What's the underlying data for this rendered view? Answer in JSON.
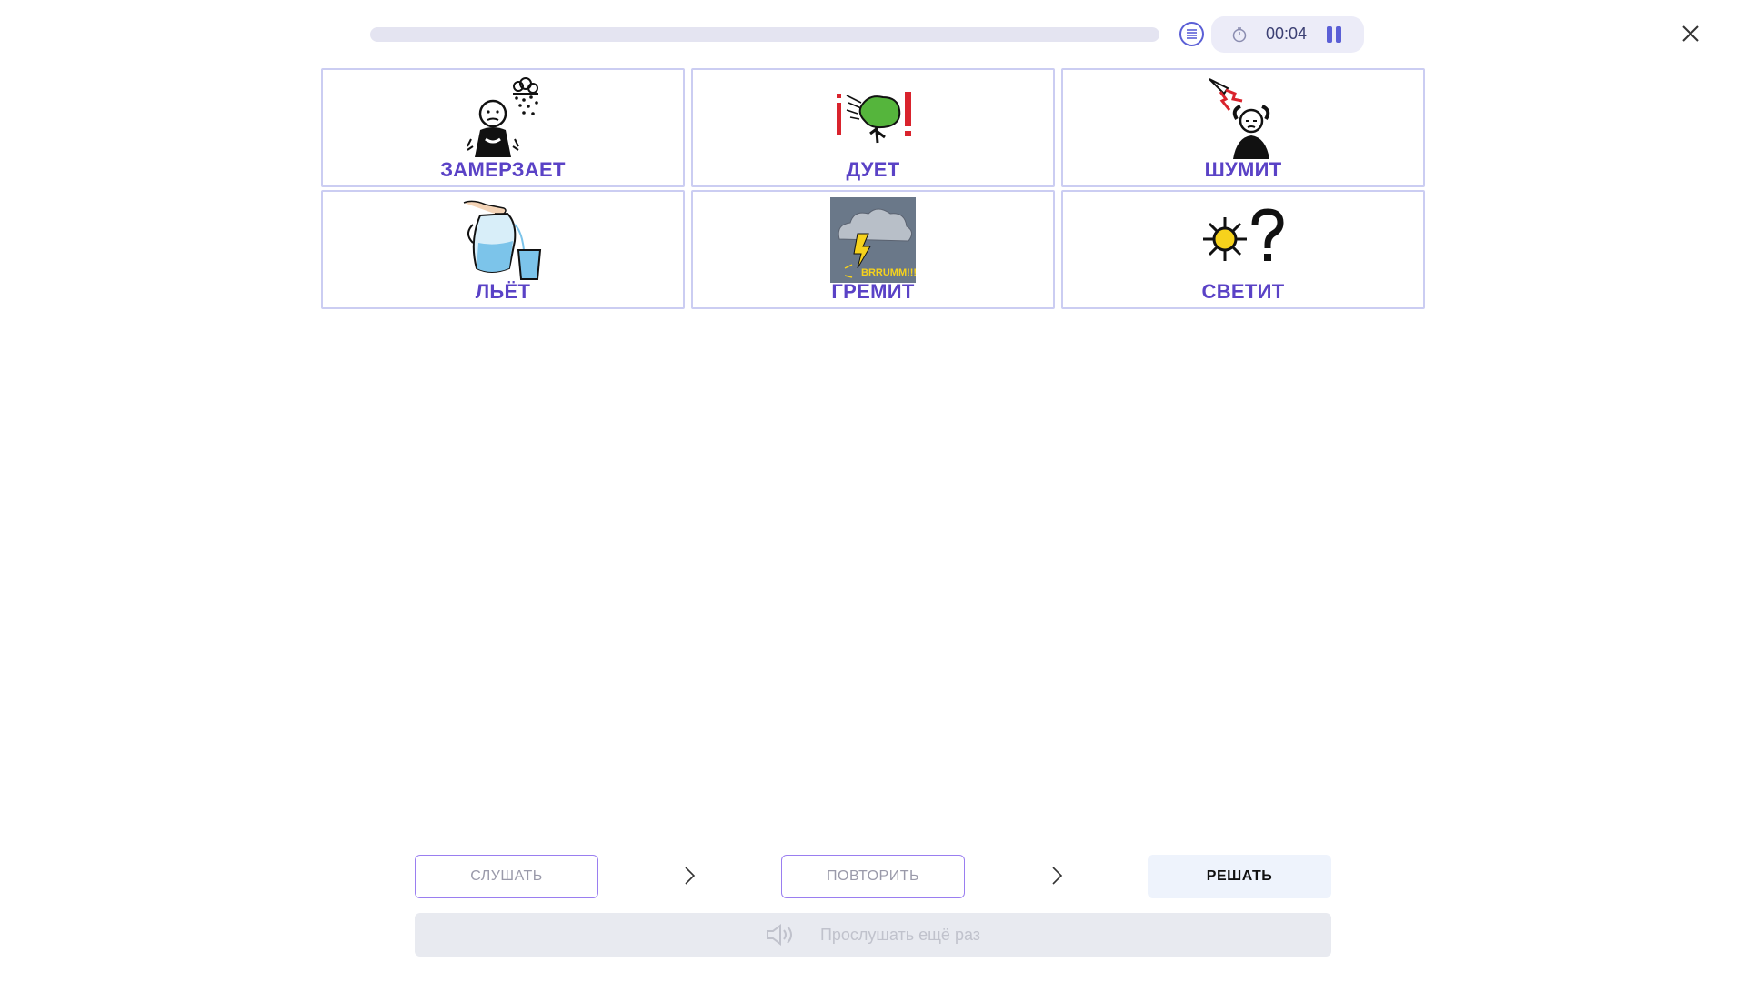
{
  "header": {
    "progress_fraction": 0,
    "timer": "00:04",
    "icons": {
      "menu": "list-icon",
      "timer": "stopwatch-icon",
      "pause": "pause-icon",
      "close": "close-icon"
    }
  },
  "cards": [
    {
      "label": "ЗАМЕРЗАЕТ",
      "icon": "freezing-person-icon"
    },
    {
      "label": "ДУЕТ",
      "icon": "wind-tree-icon"
    },
    {
      "label": "ШУМИТ",
      "icon": "noise-person-icon"
    },
    {
      "label": "ЛЬЁТ",
      "icon": "pouring-jug-icon"
    },
    {
      "label": "ГРЕМИТ",
      "icon": "thunder-cloud-icon",
      "image_text": "BRRUMM!!!"
    },
    {
      "label": "СВЕТИТ",
      "icon": "sun-question-icon"
    }
  ],
  "steps": {
    "listen": "СЛУШАТЬ",
    "repeat": "ПОВТОРИТЬ",
    "solve": "РЕШАТЬ"
  },
  "listen_again": {
    "label": "Прослушать ещё раз",
    "icon": "speaker-icon"
  },
  "colors": {
    "accent": "#5b5fd6",
    "label": "#5a42c6",
    "card_border": "#cbcdf2"
  }
}
